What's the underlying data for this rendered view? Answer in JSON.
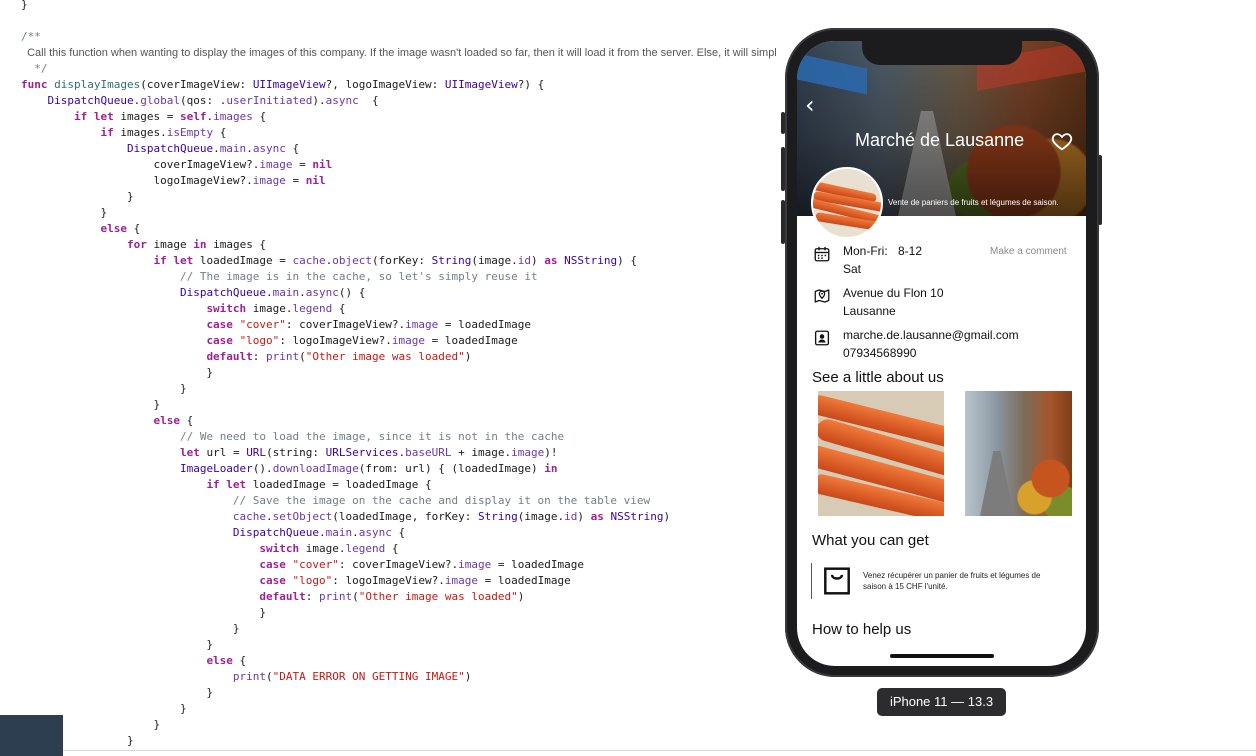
{
  "editor": {
    "lines": [
      [
        {
          "t": "}",
          "c": "plain"
        }
      ],
      [],
      [
        {
          "t": "/**",
          "c": "cm"
        }
      ],
      [
        {
          "t": "  Call this function when wanting to display the images of this company. If the image wasn't loaded so far, then it will load it from the server. Else, it will simpl",
          "c": "doc"
        }
      ],
      [
        {
          "t": "  */",
          "c": "cm"
        }
      ],
      [
        {
          "t": "func ",
          "c": "kw"
        },
        {
          "t": "displayImages",
          "c": "fn"
        },
        {
          "t": "(coverImageView: ",
          "c": "plain"
        },
        {
          "t": "UIImageView",
          "c": "ty"
        },
        {
          "t": "?, logoImageView: ",
          "c": "plain"
        },
        {
          "t": "UIImageView",
          "c": "ty"
        },
        {
          "t": "?) {",
          "c": "plain"
        }
      ],
      [
        {
          "t": "    ",
          "c": "plain"
        },
        {
          "t": "DispatchQueue",
          "c": "ty"
        },
        {
          "t": ".",
          "c": "plain"
        },
        {
          "t": "global",
          "c": "mb"
        },
        {
          "t": "(qos: .",
          "c": "plain"
        },
        {
          "t": "userInitiated",
          "c": "mb"
        },
        {
          "t": ").",
          "c": "plain"
        },
        {
          "t": "async",
          "c": "mb"
        },
        {
          "t": "  {",
          "c": "plain"
        }
      ],
      [
        {
          "t": "        ",
          "c": "plain"
        },
        {
          "t": "if let",
          "c": "kw"
        },
        {
          "t": " images = ",
          "c": "plain"
        },
        {
          "t": "self",
          "c": "kw"
        },
        {
          "t": ".",
          "c": "plain"
        },
        {
          "t": "images",
          "c": "mb"
        },
        {
          "t": " {",
          "c": "plain"
        }
      ],
      [
        {
          "t": "            ",
          "c": "plain"
        },
        {
          "t": "if",
          "c": "kw"
        },
        {
          "t": " images.",
          "c": "plain"
        },
        {
          "t": "isEmpty",
          "c": "mb"
        },
        {
          "t": " {",
          "c": "plain"
        }
      ],
      [
        {
          "t": "                ",
          "c": "plain"
        },
        {
          "t": "DispatchQueue",
          "c": "ty"
        },
        {
          "t": ".",
          "c": "plain"
        },
        {
          "t": "main",
          "c": "mb"
        },
        {
          "t": ".",
          "c": "plain"
        },
        {
          "t": "async",
          "c": "mb"
        },
        {
          "t": " {",
          "c": "plain"
        }
      ],
      [
        {
          "t": "                    coverImageView?.",
          "c": "plain"
        },
        {
          "t": "image",
          "c": "mb"
        },
        {
          "t": " = ",
          "c": "plain"
        },
        {
          "t": "nil",
          "c": "kw"
        }
      ],
      [
        {
          "t": "                    logoImageView?.",
          "c": "plain"
        },
        {
          "t": "image",
          "c": "mb"
        },
        {
          "t": " = ",
          "c": "plain"
        },
        {
          "t": "nil",
          "c": "kw"
        }
      ],
      [
        {
          "t": "                }",
          "c": "plain"
        }
      ],
      [
        {
          "t": "            }",
          "c": "plain"
        }
      ],
      [
        {
          "t": "            ",
          "c": "plain"
        },
        {
          "t": "else",
          "c": "kw"
        },
        {
          "t": " {",
          "c": "plain"
        }
      ],
      [
        {
          "t": "                ",
          "c": "plain"
        },
        {
          "t": "for",
          "c": "kw"
        },
        {
          "t": " image ",
          "c": "plain"
        },
        {
          "t": "in",
          "c": "kw"
        },
        {
          "t": " images {",
          "c": "plain"
        }
      ],
      [
        {
          "t": "                    ",
          "c": "plain"
        },
        {
          "t": "if let",
          "c": "kw"
        },
        {
          "t": " loadedImage = ",
          "c": "plain"
        },
        {
          "t": "cache",
          "c": "mb"
        },
        {
          "t": ".",
          "c": "plain"
        },
        {
          "t": "object",
          "c": "mb"
        },
        {
          "t": "(forKey: ",
          "c": "plain"
        },
        {
          "t": "String",
          "c": "ty"
        },
        {
          "t": "(image.",
          "c": "plain"
        },
        {
          "t": "id",
          "c": "mb"
        },
        {
          "t": ") ",
          "c": "plain"
        },
        {
          "t": "as",
          "c": "kw"
        },
        {
          "t": " ",
          "c": "plain"
        },
        {
          "t": "NSString",
          "c": "ty"
        },
        {
          "t": ") {",
          "c": "plain"
        }
      ],
      [
        {
          "t": "                        ",
          "c": "plain"
        },
        {
          "t": "// The image is in the cache, so let's simply reuse it",
          "c": "cm"
        }
      ],
      [
        {
          "t": "                        ",
          "c": "plain"
        },
        {
          "t": "DispatchQueue",
          "c": "ty"
        },
        {
          "t": ".",
          "c": "plain"
        },
        {
          "t": "main",
          "c": "mb"
        },
        {
          "t": ".",
          "c": "plain"
        },
        {
          "t": "async",
          "c": "mb"
        },
        {
          "t": "() {",
          "c": "plain"
        }
      ],
      [
        {
          "t": "                            ",
          "c": "plain"
        },
        {
          "t": "switch",
          "c": "kw"
        },
        {
          "t": " image.",
          "c": "plain"
        },
        {
          "t": "legend",
          "c": "mb"
        },
        {
          "t": " {",
          "c": "plain"
        }
      ],
      [
        {
          "t": "                            ",
          "c": "plain"
        },
        {
          "t": "case",
          "c": "kw"
        },
        {
          "t": " ",
          "c": "plain"
        },
        {
          "t": "\"cover\"",
          "c": "st"
        },
        {
          "t": ": coverImageView?.",
          "c": "plain"
        },
        {
          "t": "image",
          "c": "mb"
        },
        {
          "t": " = loadedImage",
          "c": "plain"
        }
      ],
      [
        {
          "t": "                            ",
          "c": "plain"
        },
        {
          "t": "case",
          "c": "kw"
        },
        {
          "t": " ",
          "c": "plain"
        },
        {
          "t": "\"logo\"",
          "c": "st"
        },
        {
          "t": ": logoImageView?.",
          "c": "plain"
        },
        {
          "t": "image",
          "c": "mb"
        },
        {
          "t": " = loadedImage",
          "c": "plain"
        }
      ],
      [
        {
          "t": "                            ",
          "c": "plain"
        },
        {
          "t": "default",
          "c": "kw"
        },
        {
          "t": ": ",
          "c": "plain"
        },
        {
          "t": "print",
          "c": "mb"
        },
        {
          "t": "(",
          "c": "plain"
        },
        {
          "t": "\"Other image was loaded\"",
          "c": "st"
        },
        {
          "t": ")",
          "c": "plain"
        }
      ],
      [
        {
          "t": "                            }",
          "c": "plain"
        }
      ],
      [
        {
          "t": "                        }",
          "c": "plain"
        }
      ],
      [
        {
          "t": "                    }",
          "c": "plain"
        }
      ],
      [
        {
          "t": "                    ",
          "c": "plain"
        },
        {
          "t": "else",
          "c": "kw"
        },
        {
          "t": " {",
          "c": "plain"
        }
      ],
      [
        {
          "t": "                        ",
          "c": "plain"
        },
        {
          "t": "// We need to load the image, since it is not in the cache",
          "c": "cm"
        }
      ],
      [
        {
          "t": "                        ",
          "c": "plain"
        },
        {
          "t": "let",
          "c": "kw"
        },
        {
          "t": " url = ",
          "c": "plain"
        },
        {
          "t": "URL",
          "c": "ty"
        },
        {
          "t": "(string: ",
          "c": "plain"
        },
        {
          "t": "URLServices",
          "c": "ty"
        },
        {
          "t": ".",
          "c": "plain"
        },
        {
          "t": "baseURL",
          "c": "mb"
        },
        {
          "t": " + image.",
          "c": "plain"
        },
        {
          "t": "image",
          "c": "mb"
        },
        {
          "t": ")!",
          "c": "plain"
        }
      ],
      [
        {
          "t": "                        ",
          "c": "plain"
        },
        {
          "t": "ImageLoader",
          "c": "ty"
        },
        {
          "t": "().",
          "c": "plain"
        },
        {
          "t": "downloadImage",
          "c": "mb"
        },
        {
          "t": "(from: url) { (loadedImage) ",
          "c": "plain"
        },
        {
          "t": "in",
          "c": "kw"
        }
      ],
      [
        {
          "t": "                            ",
          "c": "plain"
        },
        {
          "t": "if let",
          "c": "kw"
        },
        {
          "t": " loadedImage = loadedImage {",
          "c": "plain"
        }
      ],
      [
        {
          "t": "                                ",
          "c": "plain"
        },
        {
          "t": "// Save the image on the cache and display it on the table view",
          "c": "cm"
        }
      ],
      [
        {
          "t": "                                ",
          "c": "plain"
        },
        {
          "t": "cache",
          "c": "mb"
        },
        {
          "t": ".",
          "c": "plain"
        },
        {
          "t": "setObject",
          "c": "mb"
        },
        {
          "t": "(loadedImage, forKey: ",
          "c": "plain"
        },
        {
          "t": "String",
          "c": "ty"
        },
        {
          "t": "(image.",
          "c": "plain"
        },
        {
          "t": "id",
          "c": "mb"
        },
        {
          "t": ") ",
          "c": "plain"
        },
        {
          "t": "as",
          "c": "kw"
        },
        {
          "t": " ",
          "c": "plain"
        },
        {
          "t": "NSString",
          "c": "ty"
        },
        {
          "t": ")",
          "c": "plain"
        }
      ],
      [
        {
          "t": "                                ",
          "c": "plain"
        },
        {
          "t": "DispatchQueue",
          "c": "ty"
        },
        {
          "t": ".",
          "c": "plain"
        },
        {
          "t": "main",
          "c": "mb"
        },
        {
          "t": ".",
          "c": "plain"
        },
        {
          "t": "async",
          "c": "mb"
        },
        {
          "t": " {",
          "c": "plain"
        }
      ],
      [
        {
          "t": "                                    ",
          "c": "plain"
        },
        {
          "t": "switch",
          "c": "kw"
        },
        {
          "t": " image.",
          "c": "plain"
        },
        {
          "t": "legend",
          "c": "mb"
        },
        {
          "t": " {",
          "c": "plain"
        }
      ],
      [
        {
          "t": "                                    ",
          "c": "plain"
        },
        {
          "t": "case",
          "c": "kw"
        },
        {
          "t": " ",
          "c": "plain"
        },
        {
          "t": "\"cover\"",
          "c": "st"
        },
        {
          "t": ": coverImageView?.",
          "c": "plain"
        },
        {
          "t": "image",
          "c": "mb"
        },
        {
          "t": " = loadedImage",
          "c": "plain"
        }
      ],
      [
        {
          "t": "                                    ",
          "c": "plain"
        },
        {
          "t": "case",
          "c": "kw"
        },
        {
          "t": " ",
          "c": "plain"
        },
        {
          "t": "\"logo\"",
          "c": "st"
        },
        {
          "t": ": logoImageView?.",
          "c": "plain"
        },
        {
          "t": "image",
          "c": "mb"
        },
        {
          "t": " = loadedImage",
          "c": "plain"
        }
      ],
      [
        {
          "t": "                                    ",
          "c": "plain"
        },
        {
          "t": "default",
          "c": "kw"
        },
        {
          "t": ": ",
          "c": "plain"
        },
        {
          "t": "print",
          "c": "mb"
        },
        {
          "t": "(",
          "c": "plain"
        },
        {
          "t": "\"Other image was loaded\"",
          "c": "st"
        },
        {
          "t": ")",
          "c": "plain"
        }
      ],
      [
        {
          "t": "                                    }",
          "c": "plain"
        }
      ],
      [
        {
          "t": "                                }",
          "c": "plain"
        }
      ],
      [
        {
          "t": "                            }",
          "c": "plain"
        }
      ],
      [
        {
          "t": "                            ",
          "c": "plain"
        },
        {
          "t": "else",
          "c": "kw"
        },
        {
          "t": " {",
          "c": "plain"
        }
      ],
      [
        {
          "t": "                                ",
          "c": "plain"
        },
        {
          "t": "print",
          "c": "mb"
        },
        {
          "t": "(",
          "c": "plain"
        },
        {
          "t": "\"DATA ERROR ON GETTING IMAGE\"",
          "c": "st"
        },
        {
          "t": ")",
          "c": "plain"
        }
      ],
      [
        {
          "t": "                            }",
          "c": "plain"
        }
      ],
      [
        {
          "t": "                        }",
          "c": "plain"
        }
      ],
      [
        {
          "t": "                    }",
          "c": "plain"
        }
      ],
      [
        {
          "t": "                }",
          "c": "plain"
        }
      ]
    ]
  },
  "simulator": {
    "device_label": "iPhone 11 — 13.3",
    "colors": {
      "frame": "#1c1c1e",
      "label_bg": "#2c2c2e"
    },
    "app": {
      "back_icon": "chevron-left-icon",
      "title": "Marché de Lausanne",
      "favorite_icon": "heart-icon",
      "description": "Vente de paniers de fruits et légumes de saison.",
      "hours": {
        "icon": "calendar-icon",
        "days": "Mon-Fri:",
        "time": "8-12",
        "extra": "Sat"
      },
      "comment_link": "Make a comment",
      "address": {
        "icon": "map-pin-icon",
        "line1": "Avenue du Flon 10",
        "line2": "Lausanne"
      },
      "contact": {
        "icon": "contact-card-icon",
        "email": "marche.de.lausanne@gmail.com",
        "phone": "07934568990"
      },
      "about_title": "See a little about us",
      "get_title": "What you can get",
      "offer": {
        "icon": "shopping-bag-icon",
        "text": "Venez récupérer un panier de fruits et légumes de saison à 15 CHF l'unité."
      },
      "help_title": "How to help us"
    }
  }
}
